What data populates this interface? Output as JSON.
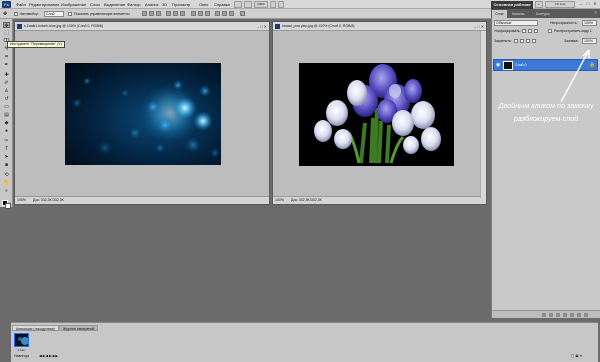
{
  "app": {
    "logo": "Ps"
  },
  "menu": [
    "Файл",
    "Редактирование",
    "Изображение",
    "Слои",
    "Выделение",
    "Фильтр",
    "Анализ",
    "3D",
    "Просмотр",
    "Окно",
    "Справка"
  ],
  "top_zoom": "100%",
  "workspace_button": "Основная рабочая",
  "top_right": {
    "search": "CS Live"
  },
  "options": {
    "auto_select_label": "Автовыбор:",
    "auto_select_value": "Слой",
    "transform_label": "Показать управляющие элементы"
  },
  "tooltip": "Инструмент \"Перемещение\" (V)",
  "doc1": {
    "title": "s.Zaalk1-bokeh-blue.jpg @ 100% (Слой 0, RGB/8)",
    "zoom": "100%",
    "status": "Док: 332,3K/332,3K"
  },
  "doc2": {
    "title": "Imaad_pow.ylep.jpg @ 100% (Слой 0, RGB/8)",
    "zoom": "100%",
    "status": "Док: 332,3K/332,3K"
  },
  "panel_tabs": [
    "Слои",
    "Каналы",
    "Контуры"
  ],
  "layers": {
    "blend_mode": "Обычные",
    "opacity_label": "Непрозрачность:",
    "opacity_value": "100%",
    "unify_label": "Унифицировать:",
    "propagate_label": "Распространить кадр 1",
    "lock_label": "Закрепить:",
    "fill_label": "Заливка:",
    "fill_value": "100%",
    "layer_name": "Слой 0"
  },
  "annotation": "Двойным кликом по замочку разблокируем слой",
  "bottom": {
    "tabs": [
      "Анимация (покадровая)",
      "Журнал измерений"
    ],
    "frame_time": "0 сек.",
    "loop": "Навсегда"
  }
}
